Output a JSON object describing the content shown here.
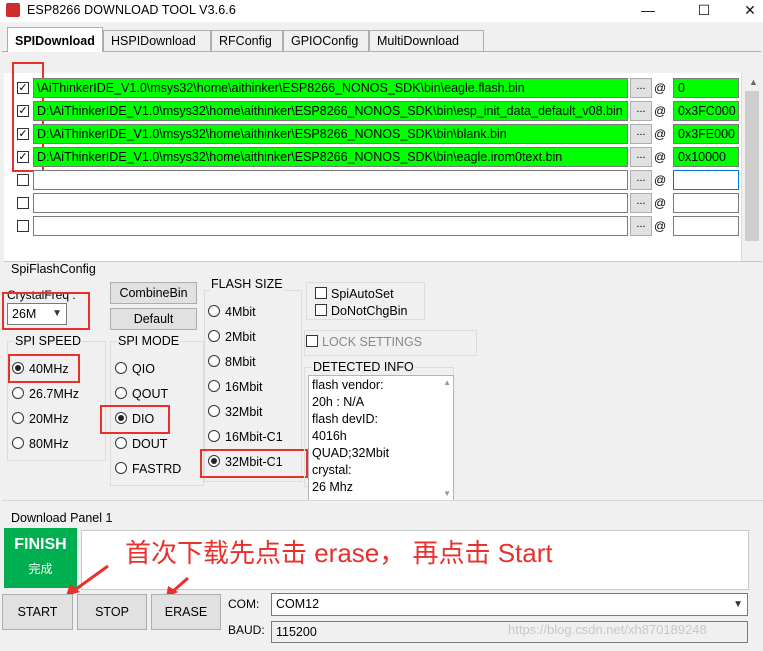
{
  "window": {
    "title": "ESP8266 DOWNLOAD TOOL V3.6.6",
    "minimize": "—",
    "maximize": "☐",
    "close": "✕"
  },
  "tabs": [
    {
      "label": "SPIDownload",
      "active": true
    },
    {
      "label": "HSPIDownload",
      "active": false
    },
    {
      "label": "RFConfig",
      "active": false
    },
    {
      "label": "GPIOConfig",
      "active": false
    },
    {
      "label": "MultiDownload",
      "active": false
    }
  ],
  "files": [
    {
      "checked": true,
      "path": "\\AiThinkerIDE_V1.0\\msys32\\home\\aithinker\\ESP8266_NONOS_SDK\\bin\\eagle.flash.bin",
      "address": "0"
    },
    {
      "checked": true,
      "path": "D:\\AiThinkerIDE_V1.0\\msys32\\home\\aithinker\\ESP8266_NONOS_SDK\\bin\\esp_init_data_default_v08.bin",
      "address": "0x3FC000"
    },
    {
      "checked": true,
      "path": "D:\\AiThinkerIDE_V1.0\\msys32\\home\\aithinker\\ESP8266_NONOS_SDK\\bin\\blank.bin",
      "address": "0x3FE000"
    },
    {
      "checked": true,
      "path": "D:\\AiThinkerIDE_V1.0\\msys32\\home\\aithinker\\ESP8266_NONOS_SDK\\bin\\eagle.irom0text.bin",
      "address": "0x10000"
    },
    {
      "checked": false,
      "path": "",
      "address": ""
    },
    {
      "checked": false,
      "path": "",
      "address": ""
    },
    {
      "checked": false,
      "path": "",
      "address": ""
    }
  ],
  "browse_label": "...",
  "at_label": "@",
  "spi_flash_config": {
    "group_label": "SpiFlashConfig",
    "crystal_label": "CrystalFreq :",
    "crystal_value": "26M",
    "combine_button": "CombineBin",
    "default_button": "Default",
    "spi_speed": {
      "label": "SPI SPEED",
      "options": [
        "40MHz",
        "26.7MHz",
        "20MHz",
        "80MHz"
      ],
      "selected": "40MHz"
    },
    "spi_mode": {
      "label": "SPI MODE",
      "options": [
        "QIO",
        "QOUT",
        "DIO",
        "DOUT",
        "FASTRD"
      ],
      "selected": "DIO"
    },
    "flash_size": {
      "label": "FLASH SIZE",
      "options": [
        "4Mbit",
        "2Mbit",
        "8Mbit",
        "16Mbit",
        "32Mbit",
        "16Mbit-C1",
        "32Mbit-C1"
      ],
      "selected": "32Mbit-C1"
    },
    "spi_auto_set": "SpiAutoSet",
    "do_not_chg_bin": "DoNotChgBin",
    "lock_settings": "LOCK SETTINGS",
    "detected_info": {
      "label": "DETECTED INFO",
      "lines": [
        "flash vendor:",
        "20h : N/A",
        "flash devID:",
        "4016h",
        "QUAD;32Mbit",
        "crystal:",
        "26 Mhz"
      ]
    }
  },
  "download_panel": {
    "label": "Download Panel 1",
    "status": "FINISH",
    "status_sub": "完成",
    "annotation": "首次下载先点击 erase， 再点击 Start"
  },
  "buttons": {
    "start": "START",
    "stop": "STOP",
    "erase": "ERASE"
  },
  "com": {
    "label": "COM:",
    "value": "COM12"
  },
  "baud": {
    "label": "BAUD:",
    "value": "115200"
  },
  "watermark": "https://blog.csdn.net/xh870189248",
  "colors": {
    "active_row": "#00ff00",
    "annotation_red": "#e8302d",
    "finish_bg": "#00b050"
  }
}
